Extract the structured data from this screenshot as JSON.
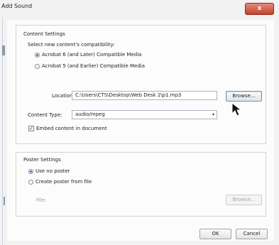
{
  "window": {
    "title": "Add Sound",
    "close_glyph": "x"
  },
  "content_settings": {
    "group_title": "Content Settings",
    "compat_prompt": "Select new content's compatibility:",
    "radio_acrobat6": "Acrobat 6 (and Later) Compatible Media",
    "radio_acrobat5": "Acrobat 5 (and Earlier) Compatible Media",
    "location_label": "Location:",
    "location_value": "C:\\Users\\CTS\\Desktop\\Web Desk 2\\p1.mp3",
    "browse_label": "Browse...",
    "content_type_label": "Content Type:",
    "content_type_value": "audio/mpeg",
    "embed_label": "Embed content in document",
    "embed_check": "✓"
  },
  "poster_settings": {
    "group_title": "Poster Settings",
    "radio_no_poster": "Use no poster",
    "radio_from_file": "Create poster from file",
    "file_label": "File:",
    "browse_label": "Browse..."
  },
  "footer": {
    "ok_label": "OK",
    "cancel_label": "Cancel"
  },
  "icons": {
    "cursor": "arrow-cursor-icon",
    "dropdown": "chevron-down-icon"
  }
}
